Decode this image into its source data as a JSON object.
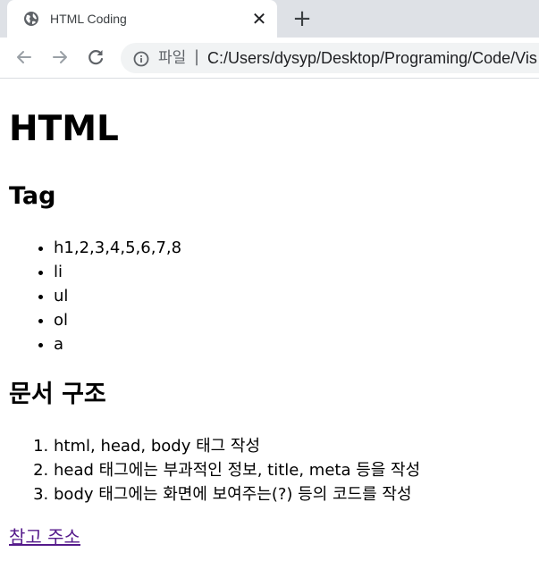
{
  "browser": {
    "tab": {
      "title": "HTML Coding",
      "favicon": "globe-icon",
      "close_label": "✕"
    },
    "new_tab_label": "+",
    "toolbar": {
      "back_icon": "arrow-left-icon",
      "forward_icon": "arrow-right-icon",
      "reload_icon": "reload-icon",
      "info_icon": "info-icon",
      "address_label": "파일",
      "address_separator": "|",
      "address_url": "C:/Users/dysyp/Desktop/Programing/Code/Vis"
    }
  },
  "page": {
    "heading": "HTML",
    "tag_section": {
      "title": "Tag",
      "items": [
        "h1,2,3,4,5,6,7,8",
        "li",
        "ul",
        "ol",
        "a"
      ]
    },
    "structure_section": {
      "title": "문서 구조",
      "items": [
        "html, head, body 태그 작성",
        "head 태그에는 부과적인 정보, title, meta 등을 작성",
        "body 태그에는 화면에 보여주는(?) 등의 코드를 작성"
      ]
    },
    "link_text": "참고 주소",
    "link_color": "#551a8b"
  }
}
